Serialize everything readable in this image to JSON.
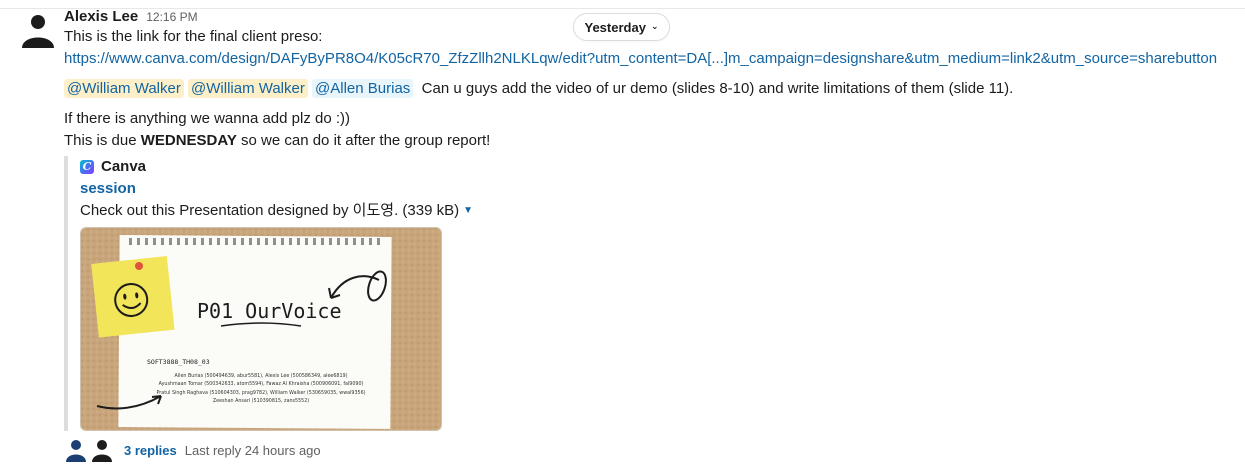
{
  "divider": {
    "date_label": "Yesterday"
  },
  "message": {
    "sender": "Alexis Lee",
    "time": "12:16 PM",
    "line1": "This is the link for the final client preso:",
    "url": "https://www.canva.com/design/DAFyByPR8O4/K05cR70_ZfzZllh2NLKLqw/edit?utm_content=DA[...]m_campaign=designshare&utm_medium=link2&utm_source=sharebutton",
    "mentions": [
      "@William Walker",
      "@William Walker",
      "@Allen Burias"
    ],
    "mentions_text": "Can u guys add the video of ur demo (slides 8-10) and write limitations of them (slide 11).",
    "line_add": "If there is anything we wanna add plz do :))",
    "due_prefix": "This is due ",
    "due_bold": "WEDNESDAY",
    "due_suffix": " so we can do it after the group report!"
  },
  "unfurl": {
    "service": "Canva",
    "icon_letter": "C",
    "title": "session",
    "description": "Check out this Presentation designed by 이도영. (339 kB)",
    "preview": {
      "slide_title": "P01 OurVoice",
      "course_code": "SOFT3888_TH08_03",
      "members": [
        "Allen Burias (500494639, abur5581), Alexis Lee (500586349, alee6819)",
        "Ayushmaan Tomar (500342633, atom5594), Fawaz Al Khraisha (500906091, fal9090)",
        "Pratul Singh Raghava (510604303, prag9782), William Walker (530659035, wwal9356)",
        "Zeeshan Ansari (510390815, zans5552)"
      ]
    }
  },
  "thread": {
    "replies": "3 replies",
    "last_reply": "Last reply 24 hours ago"
  },
  "colors": {
    "link": "#1264a3",
    "mention_bg": "#fdf0c8",
    "self_mention_bg": "#e8f5fa",
    "cork": "#c9a57c",
    "sticky": "#f3e55a"
  }
}
